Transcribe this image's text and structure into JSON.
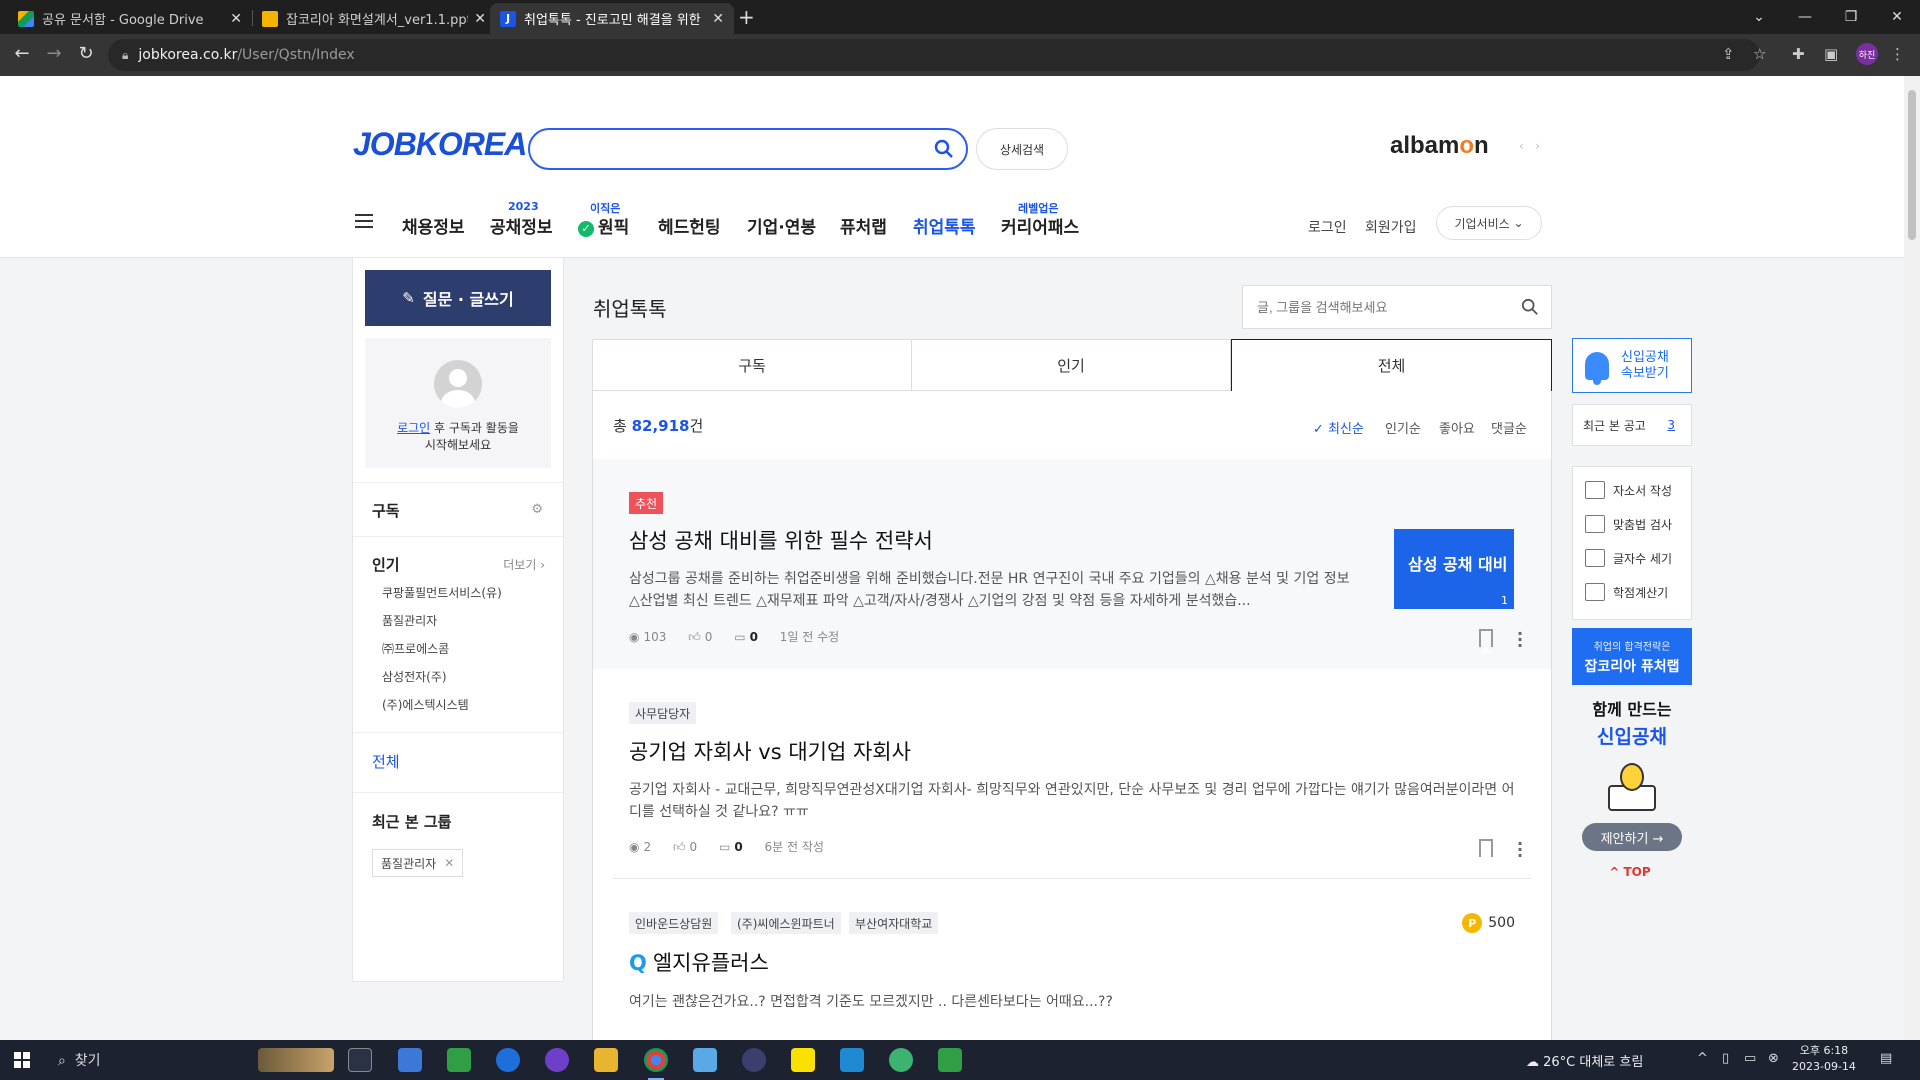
{
  "browser": {
    "tabs": [
      {
        "title": "공유 문서함 - Google Drive",
        "icon": "google-drive-icon",
        "active": false
      },
      {
        "title": "잡코리아 화면설계서_ver1.1.pptx",
        "icon": "slides-icon",
        "active": false
      },
      {
        "title": "취업톡톡 - 진로고민 해결을 위한",
        "icon": "jobkorea-j-icon",
        "active": true
      }
    ],
    "url_domain": "jobkorea.co.kr",
    "url_path": "/User/Qstn/Index",
    "profile_initials": "하진"
  },
  "header": {
    "logo": "JOBKOREA",
    "search_placeholder": "",
    "detail_search": "상세검색",
    "albamon": "albamon",
    "nav": [
      {
        "label": "채용정보",
        "badge": "",
        "active": false
      },
      {
        "label": "공채정보",
        "badge": "2023",
        "active": false
      },
      {
        "label": "원픽",
        "badge": "이직은",
        "active": false
      },
      {
        "label": "헤드헌팅",
        "badge": "",
        "active": false
      },
      {
        "label": "기업·연봉",
        "badge": "",
        "active": false
      },
      {
        "label": "퓨처랩",
        "badge": "",
        "active": false
      },
      {
        "label": "취업톡톡",
        "badge": "",
        "active": true
      },
      {
        "label": "커리어패스",
        "badge": "레벨업은",
        "active": false
      }
    ],
    "login": "로그인",
    "signup": "회원가입",
    "corp_service": "기업서비스"
  },
  "left": {
    "write_button": "질문 · 글쓰기",
    "login_link": "로그인",
    "login_msg_1": " 후 구독과 활동을",
    "login_msg_2": "시작해보세요",
    "subscribe_title": "구독",
    "popular_title": "인기",
    "more": "더보기",
    "popular_items": [
      "쿠팡풀필먼트서비스(유)",
      "품질관리자",
      "㈜프로에스콤",
      "삼성전자(주)",
      "(주)에스텍시스템"
    ],
    "all_link": "전체",
    "recent_group_title": "최근 본 그룹",
    "recent_group_chip": "품질관리자"
  },
  "main": {
    "title": "취업톡톡",
    "search_placeholder": "글, 그룹을 검색해보세요",
    "tabs": [
      "구독",
      "인기",
      "전체"
    ],
    "active_tab": 2,
    "total_prefix": "총 ",
    "total_count": "82,918",
    "total_suffix": "건",
    "sort": [
      "최신순",
      "인기순",
      "좋아요",
      "댓글순"
    ],
    "posts": [
      {
        "tags": [
          "추천"
        ],
        "title": "삼성 공채 대비를 위한 필수 전략서",
        "body": "삼성그룹 공채를 준비하는 취업준비생을 위해 준비했습니다.전문 HR 연구진이 국내 주요 기업들의 △채용 분석 및 기업 정보 △산업별 최신 트렌드 △재무제표 파악 △고객/자사/경쟁사 △기업의 강점 및 약점 등을 자세하게 분석했습...",
        "views": "103",
        "likes": "0",
        "comments": "0",
        "time": "1일 전 수정",
        "thumb_title": "삼성 공채 대비",
        "thumb_count": "1"
      },
      {
        "tags": [
          "사무담당자"
        ],
        "title": "공기업 자회사 vs 대기업 자회사",
        "body": "공기업 자회사 - 교대근무, 희망직무연관성X대기업 자회사- 희망직무와 연관있지만, 단순 사무보조 및 경리 업무에 가깝다는 얘기가 많음여러분이라면 어디를 선택하실 것 같나요? ㅠㅠ",
        "views": "2",
        "likes": "0",
        "comments": "0",
        "time": "6분 전 작성"
      },
      {
        "tags": [
          "인바운드상담원",
          "(주)씨에스윈파트너",
          "부산여자대학교"
        ],
        "title": "엘지유플러스",
        "q_mark": "Q",
        "points": "500",
        "points_icon": "P",
        "body": "여기는 괜찮은건가요..?  면접합격 기준도 모르겠지만 .. 다른센타보다는 어때요...??"
      }
    ]
  },
  "right": {
    "alert": "신입공채\n속보받기",
    "alert_l1": "신입공채",
    "alert_l2": "속보받기",
    "recent_label": "최근 본 공고",
    "recent_count": "3",
    "tools": [
      "자소서 작성",
      "맞춤법 검사",
      "글자수 세기",
      "학점계산기"
    ],
    "banner1_small": "취업의 합격전략은",
    "banner1_big": "잡코리아 퓨처랩",
    "banner2_l1": "함께 만드는",
    "banner2_l2": "신입공채",
    "suggest": "제안하기 →",
    "top": "TOP"
  },
  "taskbar": {
    "search": "찾기",
    "weather": "26°C 대체로 흐림",
    "time": "오후 6:18",
    "date": "2023-09-14"
  },
  "colors": {
    "brand_blue": "#1a55e8",
    "nav_dark": "#2c3d6e",
    "recommend_red": "#f0525a"
  }
}
